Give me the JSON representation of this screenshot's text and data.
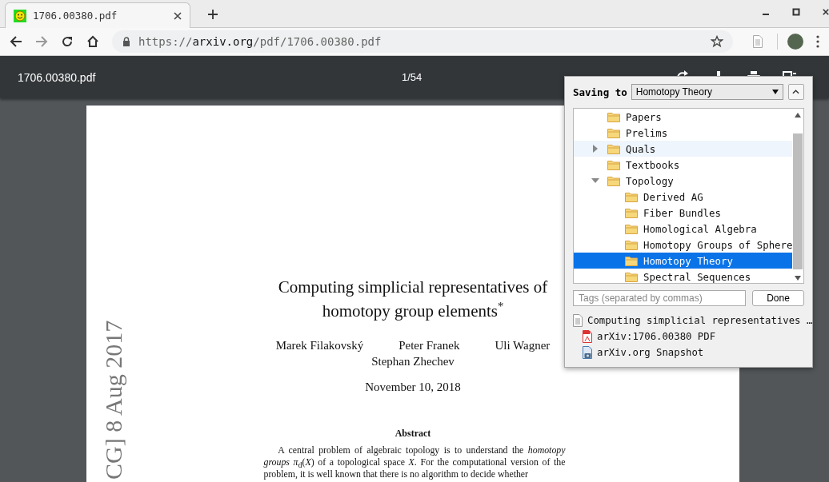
{
  "tab": {
    "title": "1706.00380.pdf"
  },
  "address": {
    "scheme": "https://",
    "host": "arxiv.org",
    "path": "/pdf/1706.00380.pdf"
  },
  "viewer": {
    "file_name": "1706.00380.pdf",
    "page_indicator": "1/54"
  },
  "paper": {
    "stamp": "CG] 8 Aug 2017",
    "title": "Computing simplicial representatives of homotopy group elements$^{*}$",
    "authors": [
      "Marek Filakovský",
      "Peter Franek",
      "Uli Wagner",
      "Stephan Zhechev"
    ],
    "date": "November 10, 2018",
    "abstract_heading": "Abstract",
    "abstract": "A central problem of algebraic topology is to understand the *homotopy groups* *π*$_{d}$(*X*) of a topological space *X*. For the computational version of the problem, it is well known that there is no algorithm to decide whether"
  },
  "save_popup": {
    "label": "Saving to",
    "collection": "Homotopy Theory",
    "tree": [
      {
        "name": "Papers",
        "selected": false,
        "highlighted": false
      },
      {
        "name": "Prelims",
        "selected": false,
        "highlighted": false
      },
      {
        "name": "Quals",
        "selected": false,
        "highlighted": true,
        "expanded": false
      },
      {
        "name": "Textbooks",
        "selected": false,
        "highlighted": false
      },
      {
        "name": "Topology",
        "selected": false,
        "highlighted": false,
        "expanded": true,
        "children": [
          {
            "name": "Derived AG",
            "selected": false,
            "highlighted": false
          },
          {
            "name": "Fiber Bundles",
            "selected": false,
            "highlighted": false
          },
          {
            "name": "Homological Algebra",
            "selected": false,
            "highlighted": false
          },
          {
            "name": "Homotopy Groups of Sphere",
            "selected": false,
            "highlighted": false
          },
          {
            "name": "Homotopy Theory",
            "selected": true,
            "highlighted": false
          },
          {
            "name": "Spectral Sequences",
            "selected": false,
            "highlighted": false
          }
        ]
      }
    ],
    "tags": {
      "placeholder": "Tags (separated by commas)"
    },
    "done": "Done",
    "items": [
      {
        "kind": "document",
        "title": "Computing simplicial representatives …",
        "children": [
          {
            "kind": "pdf",
            "title": "arXiv:1706.00380 PDF"
          },
          {
            "kind": "snapshot",
            "title": "arXiv.org Snapshot"
          }
        ]
      }
    ]
  }
}
